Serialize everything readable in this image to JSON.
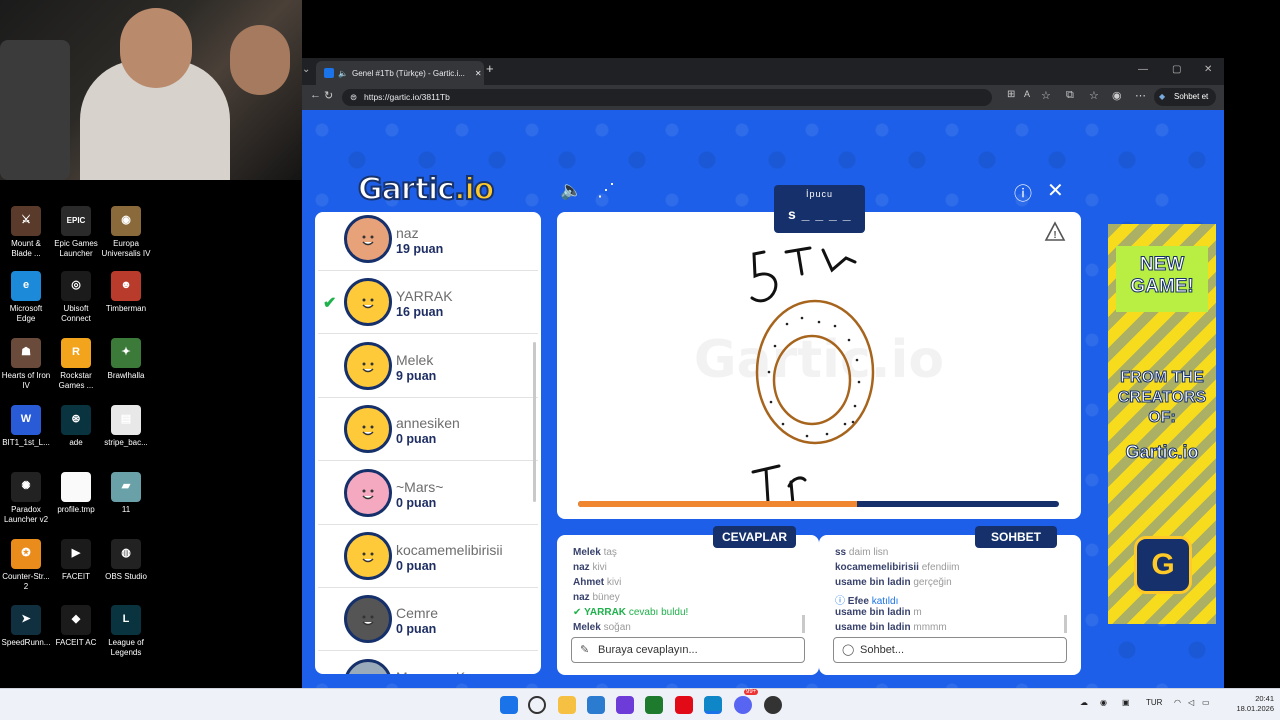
{
  "desktop": {
    "icons": [
      {
        "label": "Mount & Blade ...",
        "color": "#5a3b2b",
        "glyph": "⚔"
      },
      {
        "label": "Epic Games Launcher",
        "color": "#2a2a2a",
        "glyph": "EPIC"
      },
      {
        "label": "Europa Universalis IV",
        "color": "#8a6a3a",
        "glyph": "◉"
      },
      {
        "label": "Microsoft Edge",
        "color": "#1c8ad9",
        "glyph": "e"
      },
      {
        "label": "Ubisoft Connect",
        "color": "#1b1b1b",
        "glyph": "◎"
      },
      {
        "label": "Timberman",
        "color": "#b93b2b",
        "glyph": "☻"
      },
      {
        "label": "Hearts of Iron IV",
        "color": "#6a4a3a",
        "glyph": "☗"
      },
      {
        "label": "Rockstar Games ...",
        "color": "#f2a41c",
        "glyph": "R"
      },
      {
        "label": "Brawlhalla",
        "color": "#3c7a3a",
        "glyph": "✦"
      },
      {
        "label": "BIT1_1st_L...",
        "color": "#2a5bd7",
        "glyph": "W"
      },
      {
        "label": "ade",
        "color": "#0a3340",
        "glyph": "⊛"
      },
      {
        "label": "stripe_bac...",
        "color": "#e8e8e8",
        "glyph": "▤"
      },
      {
        "label": "Paradox Launcher v2",
        "color": "#222",
        "glyph": "✺"
      },
      {
        "label": "profile.tmp",
        "color": "#fafafa",
        "glyph": ""
      },
      {
        "label": "11",
        "color": "#6aa0a8",
        "glyph": "▰"
      },
      {
        "label": "Counter-Str... 2",
        "color": "#e98c1c",
        "glyph": "✪"
      },
      {
        "label": "FACEIT",
        "color": "#1b1b1b",
        "glyph": "▶"
      },
      {
        "label": "OBS Studio",
        "color": "#222",
        "glyph": "◍"
      },
      {
        "label": "SpeedRunn...",
        "color": "#103040",
        "glyph": "➤"
      },
      {
        "label": "FACEIT AC",
        "color": "#1b1b1b",
        "glyph": "◆"
      },
      {
        "label": "League of Legends",
        "color": "#0a3340",
        "glyph": "L"
      }
    ]
  },
  "browser": {
    "tab_title": "Genel #1Tb (Türkçe) - Gartic.i...",
    "url": "https://gartic.io/3811Tb",
    "copilot_label": "Sohbet et",
    "new_tab": "+"
  },
  "game": {
    "logo_main": "Gartic",
    "logo_suffix": ".io",
    "hint_title": "İpucu",
    "hint_word": "s _ _ _ _ _",
    "progress": 0.58,
    "players": [
      {
        "name": "naz",
        "score": "19 puan",
        "checked": false
      },
      {
        "name": "YARRAK",
        "score": "16 puan",
        "checked": true
      },
      {
        "name": "Melek",
        "score": "9 puan",
        "checked": false
      },
      {
        "name": "annesiken",
        "score": "0 puan",
        "checked": false
      },
      {
        "name": "~Mars~",
        "score": "0 puan",
        "checked": false
      },
      {
        "name": "kocamemelibirisii",
        "score": "0 puan",
        "checked": false
      },
      {
        "name": "Cemre",
        "score": "0 puan",
        "checked": false
      },
      {
        "name": "Marmara Kazım",
        "score": "",
        "checked": false
      }
    ],
    "answers_title": "CEVAPLAR",
    "chat_title": "SOHBET",
    "answers": [
      {
        "user": "Melek",
        "text": "taş"
      },
      {
        "user": "naz",
        "text": "kivi"
      },
      {
        "user": "Ahmet",
        "text": "kivi"
      },
      {
        "user": "naz",
        "text": "büney"
      },
      {
        "user": "YARRAK",
        "text": "cevabı buldu!",
        "type": "ok"
      },
      {
        "user": "Melek",
        "text": "soğan"
      }
    ],
    "chat": [
      {
        "user": "ss",
        "text": "daim lisn"
      },
      {
        "user": "kocamemelibirisii",
        "text": "efendiim"
      },
      {
        "user": "usame bin ladin",
        "text": "gerçeğin"
      },
      {
        "user": "Efee",
        "text": "katıldı",
        "type": "info"
      },
      {
        "user": "usame bin ladin",
        "text": "m"
      },
      {
        "user": "usame bin ladin",
        "text": "mmmm"
      }
    ],
    "answer_placeholder": "Buraya cevaplayın...",
    "chat_placeholder": "Sohbet...",
    "ad": {
      "line1": "NEW GAME!",
      "line2": "FROM THE CREATORS OF:",
      "line3": "Gartic.io",
      "badge": "G"
    }
  },
  "taskbar": {
    "lang": "TUR",
    "time": "20:41",
    "date": "18.01.2026",
    "notification_badge": "99+"
  }
}
